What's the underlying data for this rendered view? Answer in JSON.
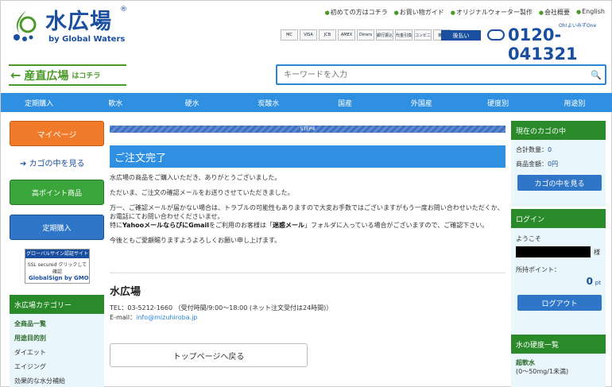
{
  "brand": {
    "title": "水広場",
    "reg": "®",
    "subtitle": "by Global Waters"
  },
  "top_links": [
    "初めての方はコチラ",
    "お買い物ガイド",
    "オリジナルウォーター製作",
    "会社概要",
    "English"
  ],
  "payment_cards": [
    "MC",
    "VISA",
    "JCB",
    "AMEX",
    "Diners",
    "銀行振込",
    "代金引換",
    "コンビニ",
    "楽天"
  ],
  "payment_button": "後払い",
  "phone": {
    "small": "Oh!よいみずOne",
    "number": "0120-041321"
  },
  "sanchoku": {
    "arrow": "←",
    "label": "産直広場",
    "small": "はコチラ"
  },
  "search": {
    "placeholder": "キーワードを入力",
    "icon": "search-icon"
  },
  "nav": [
    "定期購入",
    "軟水",
    "硬水",
    "炭酸水",
    "国産",
    "外国産",
    "硬度別",
    "用途別"
  ],
  "left": {
    "mypage": "マイページ",
    "cart_link": "➔ カゴの中を見る",
    "high_points": "高ポイント商品",
    "subscription": "定期購入",
    "globalsign": {
      "top": "グローバルサイン認証サイト",
      "mid": "SSL secured クリックして確認",
      "bot": "GlobalSign by GMO"
    },
    "category_head": "水広場カテゴリー",
    "categories": [
      "全商品一覧",
      "用途目的別",
      "ダイエット",
      "エイジング",
      "効果的な水分補給"
    ]
  },
  "main": {
    "step": "STEP4",
    "heading": "ご注文完了",
    "p1": "水広場の商品をご購入いただき、ありがとうございました。",
    "p2": "ただいま、ご注文の確認メールをお送りさせていただきました。",
    "p3a": "万一、ご確認メールが届かない場合は、トラブルの可能性もありますので大変お手数ではございますがもう一度お問い合わせいただくか、お電話にてお問い合わせくださいませ。",
    "p3b_prefix": "特に",
    "p3b_bold1": "Yahooメールならびに",
    "p3b_bold2": "Gmail",
    "p3b_mid": "をご利用のお客様は「",
    "p3b_bold3": "迷惑メール",
    "p3b_suffix": "」フォルダに入っている場合がございますので、ご確認下さい。",
    "p4": "今後ともご愛顧賜りますようよろしくお願い申し上げます。",
    "company": "水広場",
    "tel": "TEL：03-5212-1660 （受付時間/9:00～18:00 (ネット注文受付は24時間)）",
    "email_label": "E-mail：",
    "email": "info@mizuhiroba.jp",
    "back_button": "トップページへ戻る"
  },
  "right": {
    "cart_head": "現在のカゴの中",
    "total_qty_label": "合計数量：",
    "total_qty": "0",
    "total_amount_label": "商品金額：",
    "total_amount": "0円",
    "cart_button": "カゴの中を見る",
    "login_head": "ログイン",
    "welcome": "ようこそ",
    "honorific": "様",
    "points_label": "所持ポイント：",
    "points": "0",
    "points_unit": "pt",
    "logout": "ログアウト",
    "hardness_head": "水の硬度一覧",
    "soft_label": "超軟水",
    "soft_range": "(0〜50mg/1未満)"
  }
}
